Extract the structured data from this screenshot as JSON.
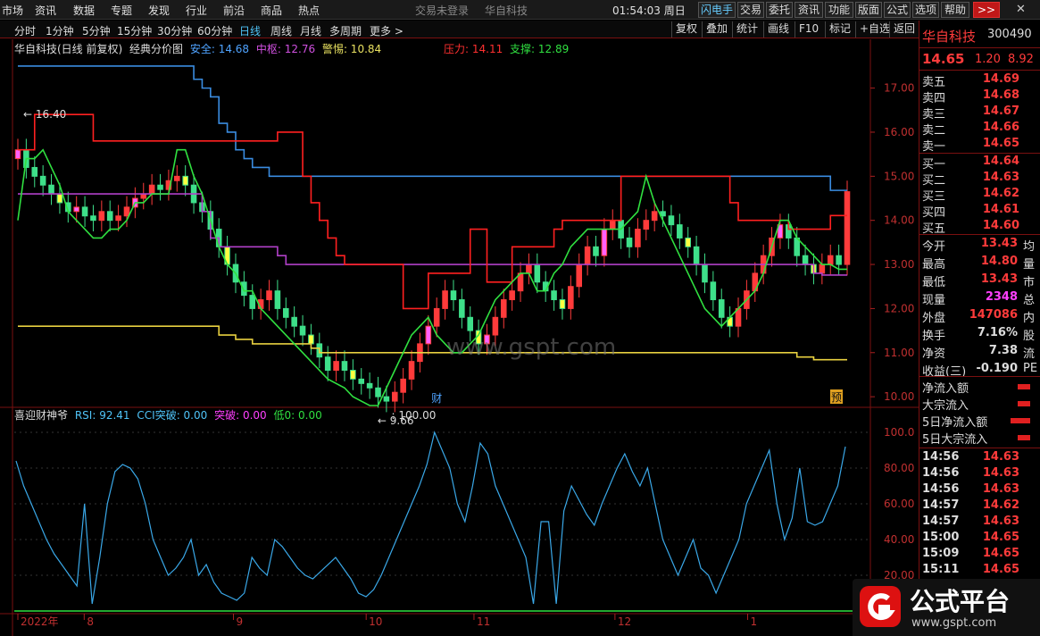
{
  "menu": {
    "items": [
      "市场",
      "资讯",
      "数据",
      "专题",
      "发现",
      "行业",
      "前沿",
      "商品",
      "热点"
    ],
    "center": [
      "交易未登录",
      "华自科技"
    ],
    "clock": "01:54:03",
    "weekday": "周日",
    "buttons": [
      "闪电手",
      "交易",
      "委托",
      "资讯",
      "功能",
      "版面",
      "公式",
      "选项",
      "帮助",
      ">>"
    ]
  },
  "periods": [
    "分时",
    "1分钟",
    "5分钟",
    "15分钟",
    "30分钟",
    "60分钟",
    "日线",
    "周线",
    "月线",
    "多周期",
    "更多 >"
  ],
  "tools": [
    "复权",
    "叠加",
    "统计",
    "画线",
    "F10",
    "标记",
    "+自选",
    "返回"
  ],
  "legend_main": {
    "title": "华自科技(日线 前复权)",
    "indicator": "经典分价图",
    "safe": "安全: 14.68",
    "mid": "中枢: 12.76",
    "warn": "警惕: 10.84",
    "pressure": "压力: 14.11",
    "support": "支撑: 12.89"
  },
  "legend_sub": {
    "name": "喜迎财神爷",
    "rsi": "RSI: 92.41",
    "cci": "CCI突破: 0.00",
    "tupo": "突破: 0.00",
    "di": "低0: 0.00",
    "top": ": 100.00"
  },
  "chart_data": {
    "type": "line",
    "price_axis": [
      "17.00",
      "16.00",
      "15.00",
      "14.00",
      "13.00",
      "12.00",
      "11.00",
      "10.00"
    ],
    "price_range": [
      9.8,
      17.6
    ],
    "osc_axis": [
      "100.0",
      "80.00",
      "60.00",
      "40.00",
      "20.00"
    ],
    "osc_range": [
      0,
      110
    ],
    "annotations": {
      "high": "16.40",
      "low": "9.66",
      "cai": "财",
      "yu": "预"
    },
    "x_labels": [
      "2022年",
      "8",
      "9",
      "10",
      "11",
      "12",
      "1"
    ],
    "close": [
      15.6,
      15.2,
      15.0,
      14.8,
      14.6,
      14.4,
      14.2,
      14.3,
      14.1,
      14.0,
      14.2,
      14.0,
      14.1,
      14.3,
      14.5,
      14.6,
      14.8,
      14.7,
      14.9,
      15.0,
      14.8,
      14.4,
      14.2,
      13.8,
      13.4,
      13.0,
      12.6,
      12.3,
      12.0,
      12.2,
      12.4,
      12.0,
      11.8,
      11.6,
      11.4,
      11.2,
      10.9,
      10.6,
      10.8,
      10.6,
      10.4,
      10.3,
      10.2,
      10.0,
      9.9,
      10.1,
      10.4,
      10.8,
      11.2,
      11.6,
      12.0,
      12.4,
      12.2,
      11.8,
      11.5,
      11.2,
      11.4,
      11.8,
      12.2,
      12.4,
      12.8,
      13.0,
      12.6,
      12.4,
      12.2,
      12.0,
      12.5,
      13.0,
      13.4,
      13.2,
      13.8,
      14.0,
      13.6,
      13.4,
      13.8,
      14.0,
      14.2,
      14.1,
      13.9,
      13.6,
      13.4,
      13.0,
      12.6,
      12.2,
      11.8,
      11.6,
      12.0,
      12.4,
      12.8,
      13.2,
      13.6,
      13.9,
      13.6,
      13.2,
      13.0,
      12.8,
      13.0,
      13.2,
      13.0,
      14.65
    ],
    "pressure": [
      15.6,
      15.6,
      16.4,
      16.4,
      16.4,
      16.4,
      16.4,
      16.4,
      16.4,
      15.8,
      15.8,
      15.8,
      15.8,
      15.8,
      15.8,
      15.8,
      15.8,
      15.8,
      15.8,
      15.8,
      15.8,
      15.8,
      15.8,
      15.8,
      15.8,
      15.8,
      15.8,
      15.8,
      15.8,
      15.8,
      15.8,
      16.0,
      16.0,
      16.0,
      15.0,
      14.4,
      14.0,
      13.6,
      13.2,
      13.0,
      13.0,
      13.0,
      13.0,
      13.0,
      13.0,
      13.0,
      12.0,
      12.0,
      12.0,
      12.8,
      12.8,
      12.8,
      12.8,
      12.8,
      13.8,
      13.8,
      12.6,
      12.6,
      12.6,
      13.4,
      13.4,
      13.4,
      13.4,
      13.4,
      13.8,
      14.0,
      14.0,
      14.0,
      14.0,
      14.0,
      14.0,
      14.0,
      15.0,
      15.0,
      15.0,
      15.0,
      15.0,
      15.0,
      15.0,
      15.0,
      15.0,
      15.0,
      15.0,
      15.0,
      15.0,
      14.4,
      14.0,
      14.0,
      14.0,
      14.0,
      14.0,
      14.0,
      13.8,
      13.8,
      13.8,
      13.8,
      13.8,
      14.11,
      14.11,
      14.11
    ],
    "support": [
      14.0,
      15.4,
      15.4,
      15.6,
      15.2,
      14.8,
      14.2,
      14.0,
      13.8,
      13.6,
      13.6,
      13.8,
      13.8,
      14.0,
      14.4,
      14.4,
      14.6,
      14.6,
      14.6,
      15.6,
      15.6,
      15.0,
      14.6,
      14.0,
      13.4,
      13.0,
      12.8,
      12.4,
      12.4,
      12.0,
      11.8,
      11.6,
      11.4,
      11.2,
      11.0,
      10.8,
      10.6,
      10.4,
      10.3,
      10.2,
      10.0,
      9.9,
      9.8,
      9.8,
      10.2,
      10.6,
      11.0,
      11.4,
      11.6,
      11.8,
      11.4,
      11.2,
      11.0,
      11.0,
      11.2,
      11.4,
      11.8,
      12.2,
      12.4,
      12.6,
      12.8,
      12.8,
      12.4,
      12.4,
      12.8,
      13.0,
      13.4,
      13.6,
      13.8,
      13.8,
      13.8,
      13.8,
      13.8,
      14.0,
      14.2,
      15.0,
      14.4,
      14.0,
      13.6,
      13.2,
      12.8,
      12.4,
      12.0,
      11.8,
      11.6,
      11.8,
      12.0,
      12.2,
      12.4,
      12.8,
      13.4,
      14.0,
      14.0,
      13.6,
      13.4,
      13.2,
      13.0,
      13.0,
      12.89,
      12.89
    ],
    "safe": [
      17.5,
      17.5,
      17.5,
      17.5,
      17.5,
      17.5,
      17.5,
      17.5,
      17.5,
      17.5,
      17.5,
      17.5,
      17.5,
      17.5,
      17.5,
      17.5,
      17.5,
      17.5,
      17.5,
      17.5,
      17.5,
      17.2,
      17.0,
      16.8,
      16.2,
      16.0,
      15.6,
      15.4,
      15.2,
      15.2,
      15.0,
      15.0,
      15.0,
      15.0,
      15.0,
      15.0,
      15.0,
      15.0,
      15.0,
      15.0,
      15.0,
      15.0,
      15.0,
      15.0,
      15.0,
      15.0,
      15.0,
      15.0,
      15.0,
      15.0,
      15.0,
      15.0,
      15.0,
      15.0,
      15.0,
      15.0,
      15.0,
      15.0,
      15.0,
      15.0,
      15.0,
      15.0,
      15.0,
      15.0,
      15.0,
      15.0,
      15.0,
      15.0,
      15.0,
      15.0,
      15.0,
      15.0,
      15.0,
      15.0,
      15.0,
      15.0,
      15.0,
      15.0,
      15.0,
      15.0,
      15.0,
      15.0,
      15.0,
      15.0,
      15.0,
      15.0,
      15.0,
      15.0,
      15.0,
      15.0,
      15.0,
      15.0,
      15.0,
      15.0,
      15.0,
      15.0,
      15.0,
      14.68,
      14.68,
      14.68
    ],
    "mid": [
      14.6,
      14.6,
      14.6,
      14.6,
      14.6,
      14.6,
      14.6,
      14.6,
      14.6,
      14.6,
      14.6,
      14.6,
      14.6,
      14.6,
      14.6,
      14.6,
      14.6,
      14.6,
      14.6,
      14.6,
      14.6,
      14.6,
      14.2,
      13.6,
      13.4,
      13.4,
      13.4,
      13.4,
      13.4,
      13.4,
      13.4,
      13.2,
      13.0,
      13.0,
      13.0,
      13.0,
      13.0,
      13.0,
      13.0,
      13.0,
      13.0,
      13.0,
      13.0,
      13.0,
      13.0,
      13.0,
      13.0,
      13.0,
      13.0,
      13.0,
      13.0,
      13.0,
      13.0,
      13.0,
      13.0,
      13.0,
      13.0,
      13.0,
      13.0,
      13.0,
      13.0,
      13.0,
      13.0,
      13.0,
      13.0,
      13.0,
      13.0,
      13.0,
      13.0,
      13.0,
      13.0,
      13.0,
      13.0,
      13.0,
      13.0,
      13.0,
      13.0,
      13.0,
      13.0,
      13.0,
      13.0,
      13.0,
      13.0,
      13.0,
      13.0,
      13.0,
      13.0,
      13.0,
      13.0,
      13.0,
      13.0,
      13.0,
      13.0,
      13.0,
      13.0,
      12.8,
      12.76,
      12.76,
      12.76,
      12.76
    ],
    "warn": [
      11.6,
      11.6,
      11.6,
      11.6,
      11.6,
      11.6,
      11.6,
      11.6,
      11.6,
      11.6,
      11.6,
      11.6,
      11.6,
      11.6,
      11.6,
      11.6,
      11.6,
      11.6,
      11.6,
      11.6,
      11.6,
      11.6,
      11.6,
      11.6,
      11.4,
      11.4,
      11.3,
      11.3,
      11.2,
      11.2,
      11.2,
      11.2,
      11.2,
      11.2,
      11.2,
      11.1,
      11.0,
      11.0,
      11.0,
      11.0,
      11.0,
      11.0,
      11.0,
      11.0,
      11.0,
      11.0,
      11.0,
      11.0,
      11.0,
      11.0,
      11.0,
      11.0,
      11.0,
      11.0,
      11.0,
      11.0,
      11.0,
      11.0,
      11.0,
      11.0,
      11.0,
      11.0,
      11.0,
      11.0,
      11.0,
      11.0,
      11.0,
      11.0,
      11.0,
      11.0,
      11.0,
      11.0,
      11.0,
      11.0,
      11.0,
      11.0,
      11.0,
      11.0,
      11.0,
      11.0,
      11.0,
      11.0,
      11.0,
      11.0,
      11.0,
      11.0,
      11.0,
      11.0,
      11.0,
      11.0,
      11.0,
      11.0,
      11.0,
      10.9,
      10.9,
      10.84,
      10.84,
      10.84,
      10.84,
      10.84
    ],
    "rsi": [
      84,
      70,
      60,
      50,
      40,
      32,
      26,
      20,
      14,
      60,
      4,
      30,
      60,
      78,
      82,
      80,
      74,
      60,
      40,
      30,
      20,
      24,
      30,
      40,
      20,
      26,
      16,
      10,
      8,
      6,
      10,
      30,
      24,
      20,
      40,
      36,
      30,
      24,
      20,
      18,
      22,
      26,
      30,
      24,
      18,
      10,
      8,
      12,
      20,
      30,
      40,
      50,
      60,
      70,
      82,
      100,
      90,
      80,
      60,
      50,
      70,
      94,
      88,
      70,
      60,
      50,
      40,
      30,
      4,
      50,
      50,
      4,
      56,
      70,
      62,
      54,
      48,
      60,
      70,
      80,
      88,
      78,
      70,
      80,
      60,
      40,
      30,
      20,
      30,
      40,
      24,
      20,
      10,
      20,
      30,
      40,
      60,
      70,
      80,
      90,
      60,
      40,
      52,
      80,
      50,
      48,
      50,
      60,
      70,
      92
    ]
  },
  "right_panel": {
    "name": "华自科技",
    "code": "300490",
    "price": "14.65",
    "change": "1.20",
    "pct": "8.92",
    "asks": [
      [
        "卖五",
        "14.69"
      ],
      [
        "卖四",
        "14.68"
      ],
      [
        "卖三",
        "14.67"
      ],
      [
        "卖二",
        "14.66"
      ],
      [
        "卖一",
        "14.65"
      ]
    ],
    "bids": [
      [
        "买一",
        "14.64"
      ],
      [
        "买二",
        "14.63"
      ],
      [
        "买三",
        "14.62"
      ],
      [
        "买四",
        "14.61"
      ],
      [
        "买五",
        "14.60"
      ]
    ],
    "stats": [
      [
        "今开",
        "13.43",
        "均"
      ],
      [
        "最高",
        "14.80",
        "量"
      ],
      [
        "最低",
        "13.43",
        "市"
      ],
      [
        "现量",
        "2348",
        "总"
      ],
      [
        "外盘",
        "147086",
        "内"
      ],
      [
        "换手",
        "7.16%",
        "股"
      ],
      [
        "净资",
        "7.38",
        "流"
      ],
      [
        "收益(三)",
        "-0.190",
        "PE"
      ]
    ],
    "flows": [
      "净流入额",
      "大宗流入",
      "5日净流入额",
      "5日大宗流入"
    ],
    "ticks": [
      [
        "14:56",
        "14.63"
      ],
      [
        "14:56",
        "14.63"
      ],
      [
        "14:56",
        "14.63"
      ],
      [
        "14:57",
        "14.62"
      ],
      [
        "14:57",
        "14.63"
      ],
      [
        "15:00",
        "14.65"
      ],
      [
        "15:09",
        "14.65"
      ],
      [
        "15:11",
        "14.65"
      ]
    ]
  },
  "watermark": "www.gspt.com",
  "badge": {
    "title": "公式平台",
    "url": "www.gspt.com"
  }
}
